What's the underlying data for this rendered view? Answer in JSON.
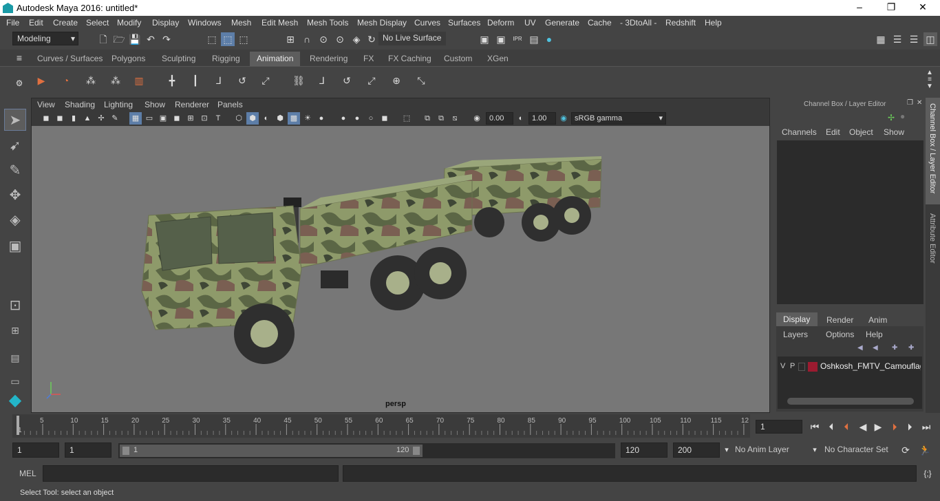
{
  "window": {
    "title": "Autodesk Maya 2016: untitled*"
  },
  "menus": [
    "File",
    "Edit",
    "Create",
    "Select",
    "Modify",
    "Display",
    "Windows",
    "Mesh",
    "Edit Mesh",
    "Mesh Tools",
    "Mesh Display",
    "Curves",
    "Surfaces",
    "Deform",
    "UV",
    "Generate",
    "Cache",
    "- 3DtoAll -",
    "Redshift",
    "Help"
  ],
  "statusline": {
    "mode": "Modeling",
    "live_surface": "No Live Surface"
  },
  "shelf_tabs": [
    "Curves / Surfaces",
    "Polygons",
    "Sculpting",
    "Rigging",
    "Animation",
    "Rendering",
    "FX",
    "FX Caching",
    "Custom",
    "XGen"
  ],
  "active_shelf_tab": "Animation",
  "viewport": {
    "menus": [
      "View",
      "Shading",
      "Lighting",
      "Show",
      "Renderer",
      "Panels"
    ],
    "exposure": "0.00",
    "gamma": "1.00",
    "color_space": "sRGB gamma",
    "camera_label": "persp"
  },
  "channel_box": {
    "title": "Channel Box / Layer Editor",
    "menus": [
      "Channels",
      "Edit",
      "Object",
      "Show"
    ],
    "layer_tabs": [
      "Display",
      "Render",
      "Anim"
    ],
    "layer_menus": [
      "Layers",
      "Options",
      "Help"
    ],
    "layer": {
      "v": "V",
      "p": "P",
      "name": "Oshkosh_FMTV_Camouflage",
      "color": "#9b1b30"
    }
  },
  "side_tabs": [
    "Channel Box / Layer Editor",
    "Attribute Editor"
  ],
  "timeline": {
    "ticks": [
      "5",
      "10",
      "15",
      "20",
      "25",
      "30",
      "35",
      "40",
      "45",
      "50",
      "55",
      "60",
      "65",
      "70",
      "75",
      "80",
      "85",
      "90",
      "95",
      "100",
      "105",
      "110",
      "115",
      "12"
    ],
    "start_label": "1",
    "current_frame": "1"
  },
  "range": {
    "start": "1",
    "anim_start": "1",
    "slider_start": "1",
    "slider_end": "120",
    "end": "120",
    "anim_end": "200",
    "anim_layer": "No Anim Layer",
    "character_set": "No Character Set"
  },
  "cmdline": {
    "label": "MEL"
  },
  "helpline": {
    "text": "Select Tool: select an object"
  },
  "colors": {
    "accent": "#5d5d5d",
    "panel": "#444444",
    "field": "#2b2b2b",
    "viewport_bg": "#777777"
  }
}
